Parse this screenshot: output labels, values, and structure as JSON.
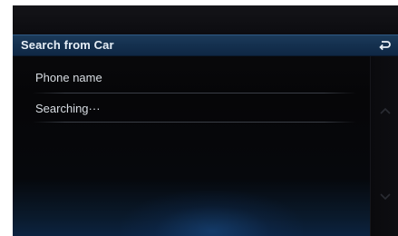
{
  "header": {
    "title": "Search from Car",
    "back_icon": "back-return-icon"
  },
  "list": {
    "items": [
      {
        "label": "Phone name"
      },
      {
        "label": "Searching···"
      }
    ]
  },
  "scrollbar": {
    "up_icon": "chevron-up-icon",
    "down_icon": "chevron-down-icon"
  },
  "colors": {
    "title_bar": "#14304e",
    "background": "#060608",
    "text": "#d8dde3"
  }
}
